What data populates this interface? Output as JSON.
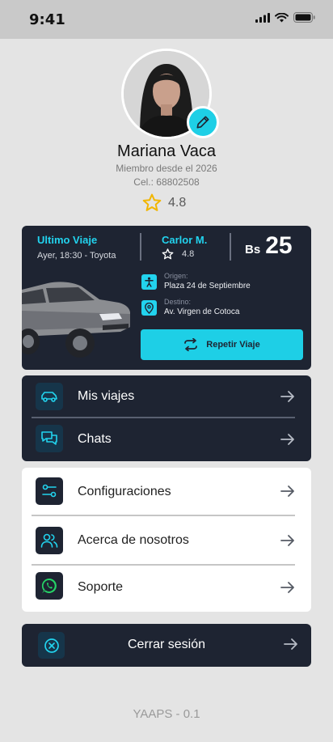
{
  "status_bar": {
    "time": "9:41"
  },
  "profile": {
    "name": "Mariana Vaca",
    "member_since": "Miembro desde el 2026",
    "phone": "Cel.: 68802508",
    "rating": "4.8"
  },
  "last_trip": {
    "title": "Ultimo Viaje",
    "time": "Ayer, 18:30 - Toyota",
    "driver_name": "Carlor M.",
    "driver_rating": "4.8",
    "currency": "Bs",
    "price": "25",
    "origin_label": "Origen:",
    "origin_value": "Plaza 24 de Septiembre",
    "destination_label": "Destino:",
    "destination_value": "Av. Virgen de Cotoca",
    "repeat_label": "Repetir Viaje"
  },
  "menu_primary": [
    {
      "label": "Mis viajes",
      "icon": "car-icon"
    },
    {
      "label": "Chats",
      "icon": "chat-icon"
    }
  ],
  "menu_secondary": [
    {
      "label": "Configuraciones",
      "icon": "settings-sliders-icon"
    },
    {
      "label": "Acerca de nosotros",
      "icon": "users-icon"
    },
    {
      "label": "Soporte",
      "icon": "whatsapp-icon"
    }
  ],
  "logout": {
    "label": "Cerrar sesión",
    "icon": "close-circle-icon"
  },
  "footer": {
    "version": "YAAPS - 0.1"
  },
  "colors": {
    "accent": "#1ecfe6",
    "dark_card": "#1e2432",
    "background": "#e4e4e4"
  }
}
